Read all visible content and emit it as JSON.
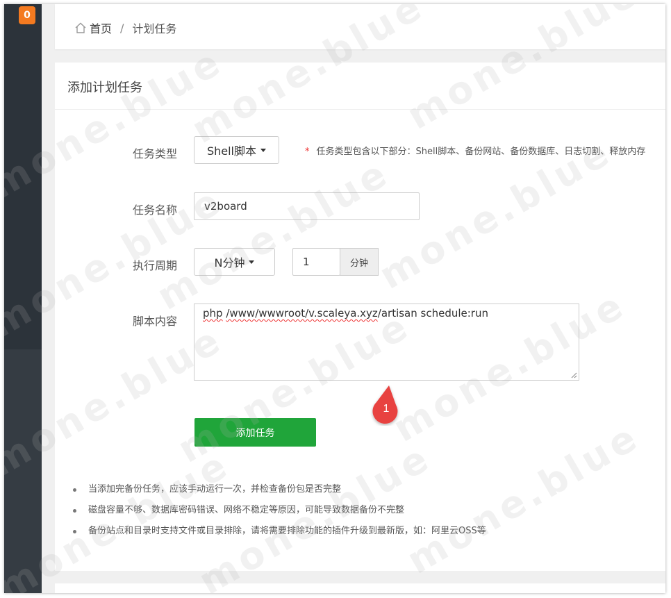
{
  "sidebar": {
    "badge_count": "0"
  },
  "breadcrumb": {
    "home": "首页",
    "separator": "/",
    "current": "计划任务"
  },
  "card": {
    "title": "添加计划任务"
  },
  "form": {
    "task_type": {
      "label": "任务类型",
      "value": "Shell脚本"
    },
    "hint": {
      "star": "*",
      "text": "任务类型包含以下部分：Shell脚本、备份网站、备份数据库、日志切割、释放内存"
    },
    "task_name": {
      "label": "任务名称",
      "value": "v2board"
    },
    "cycle": {
      "label": "执行周期",
      "value": "N分钟",
      "number": "1",
      "unit": "分钟"
    },
    "script": {
      "label": "脚本内容",
      "parts": [
        "php",
        " ",
        "/www/wwwroot/v.scaleya.xyz",
        "/artisan schedule:run"
      ]
    },
    "submit_label": "添加任务"
  },
  "notes": [
    "当添加完备份任务，应该手动运行一次，并检查备份包是否完整",
    "磁盘容量不够、数据库密码错误、网络不稳定等原因，可能导致数据备份不完整",
    "备份站点和目录时支持文件或目录排除，请将需要排除功能的插件升级到最新版，如：阿里云OSS等"
  ],
  "annotation": {
    "marker_number": "1"
  },
  "watermark": {
    "text": "mone.blue"
  },
  "colors": {
    "primary_green": "#20a53a",
    "badge_orange": "#f47a20",
    "marker_red": "#e8423f",
    "sidebar_dark": "#2c333a"
  }
}
